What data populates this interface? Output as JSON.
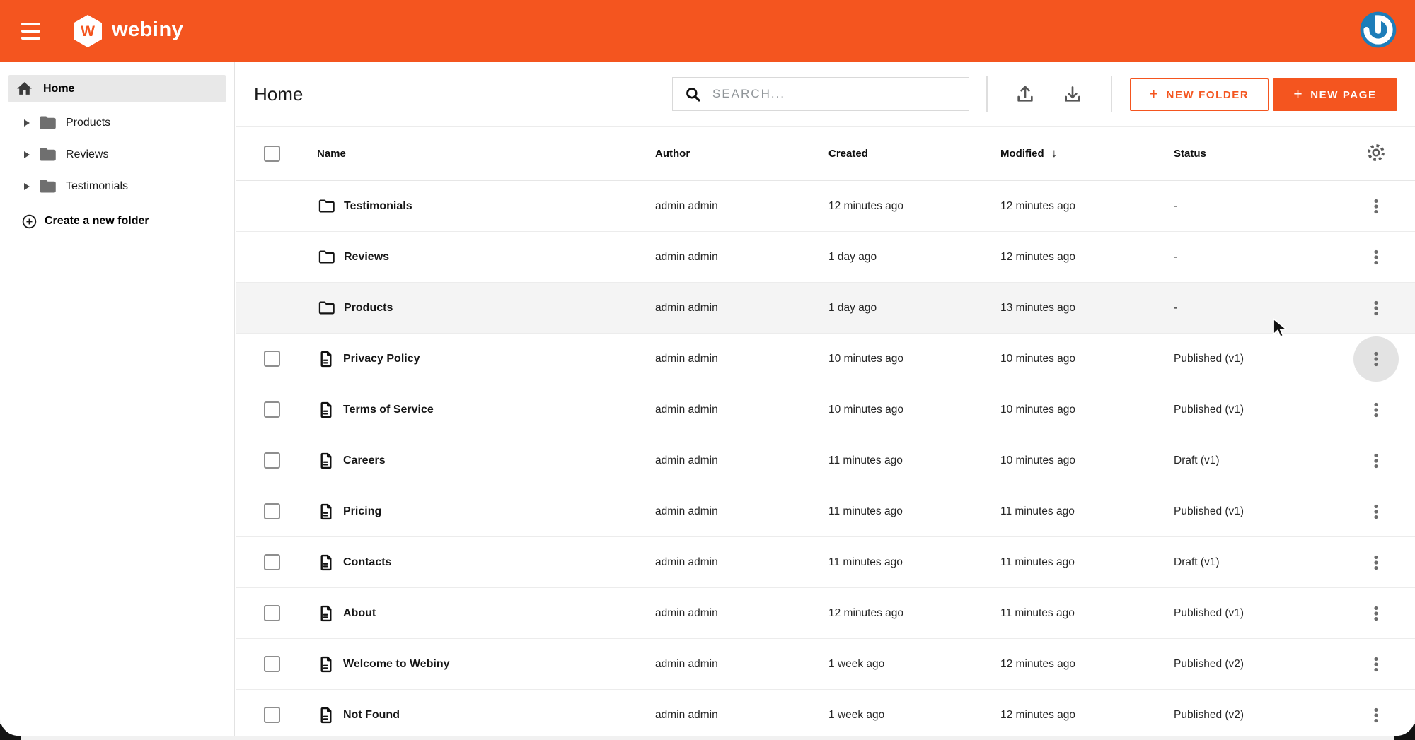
{
  "topbar": {
    "brand": "webiny"
  },
  "sidebar": {
    "items": [
      {
        "label": "Home",
        "active": true
      },
      {
        "label": "Products"
      },
      {
        "label": "Reviews"
      },
      {
        "label": "Testimonials"
      }
    ],
    "create_folder_label": "Create a new folder"
  },
  "header": {
    "title": "Home",
    "search_placeholder": "SEARCH...",
    "plus": "+",
    "new_folder_label": "NEW FOLDER",
    "new_page_label": "NEW PAGE"
  },
  "table": {
    "columns": {
      "name": "Name",
      "author": "Author",
      "created": "Created",
      "modified": "Modified",
      "status": "Status"
    },
    "sort_indicator": "↓",
    "rows": [
      {
        "name": "Testimonials",
        "type": "folder",
        "author": "admin admin",
        "created": "12 minutes ago",
        "modified": "12 minutes ago",
        "status": "-"
      },
      {
        "name": "Reviews",
        "type": "folder",
        "author": "admin admin",
        "created": "1 day ago",
        "modified": "12 minutes ago",
        "status": "-"
      },
      {
        "name": "Products",
        "type": "folder",
        "author": "admin admin",
        "created": "1 day ago",
        "modified": "13 minutes ago",
        "status": "-",
        "hover": true
      },
      {
        "name": "Privacy Policy",
        "type": "page",
        "author": "admin admin",
        "created": "10 minutes ago",
        "modified": "10 minutes ago",
        "status": "Published (v1)",
        "menu_focus": true
      },
      {
        "name": "Terms of Service",
        "type": "page",
        "author": "admin admin",
        "created": "10 minutes ago",
        "modified": "10 minutes ago",
        "status": "Published (v1)"
      },
      {
        "name": "Careers",
        "type": "page",
        "author": "admin admin",
        "created": "11 minutes ago",
        "modified": "10 minutes ago",
        "status": "Draft (v1)"
      },
      {
        "name": "Pricing",
        "type": "page",
        "author": "admin admin",
        "created": "11 minutes ago",
        "modified": "11 minutes ago",
        "status": "Published (v1)"
      },
      {
        "name": "Contacts",
        "type": "page",
        "author": "admin admin",
        "created": "11 minutes ago",
        "modified": "11 minutes ago",
        "status": "Draft (v1)"
      },
      {
        "name": "About",
        "type": "page",
        "author": "admin admin",
        "created": "12 minutes ago",
        "modified": "11 minutes ago",
        "status": "Published (v1)"
      },
      {
        "name": "Welcome to Webiny",
        "type": "page",
        "author": "admin admin",
        "created": "1 week ago",
        "modified": "12 minutes ago",
        "status": "Published (v2)"
      },
      {
        "name": "Not Found",
        "type": "page",
        "author": "admin admin",
        "created": "1 week ago",
        "modified": "12 minutes ago",
        "status": "Published (v2)"
      }
    ]
  },
  "icons": {
    "menu-icon": "☰",
    "webiny-logo": "hexagon-W",
    "avatar-icon": "gravatar-G",
    "home-icon": "⌂",
    "folder-icon": "🗀",
    "caret-right-icon": "▸",
    "circle-plus-icon": "⊕",
    "search-icon": "🔍",
    "upload-icon": "↥",
    "download-icon": "↧",
    "gear-icon": "⚙",
    "sort-desc-icon": "↓",
    "page-icon": "🗎",
    "kebab-menu-icon": "⋮",
    "checkbox": "☐"
  },
  "colors": {
    "accent": "#F4551F",
    "topbar_bg": "#F4551F",
    "avatar_blue": "#1D7DB9",
    "row_hover": "#F4F4F4",
    "menu_focus_circle": "#E3E3E3"
  }
}
